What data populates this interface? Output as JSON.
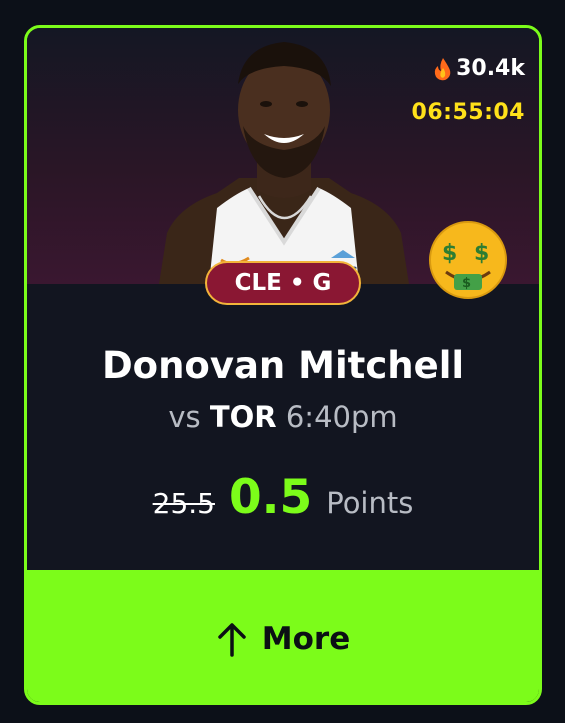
{
  "popularity": {
    "icon": "fire-icon",
    "count": "30.4k"
  },
  "countdown": "06:55:04",
  "emoji": "money-mouth-face",
  "team_position": "CLE • G",
  "player_name": "Donovan Mitchell",
  "matchup": {
    "prefix": "vs",
    "opponent": "TOR",
    "time": "6:40pm"
  },
  "projection": {
    "original": "25.5",
    "current": "0.5",
    "stat": "Points"
  },
  "action": {
    "icon": "arrow-up-icon",
    "label": "More"
  },
  "colors": {
    "accent": "#7cfc1a",
    "timer": "#ffe11a",
    "team_badge": "#8a1733",
    "badge_border": "#f3b43a"
  }
}
